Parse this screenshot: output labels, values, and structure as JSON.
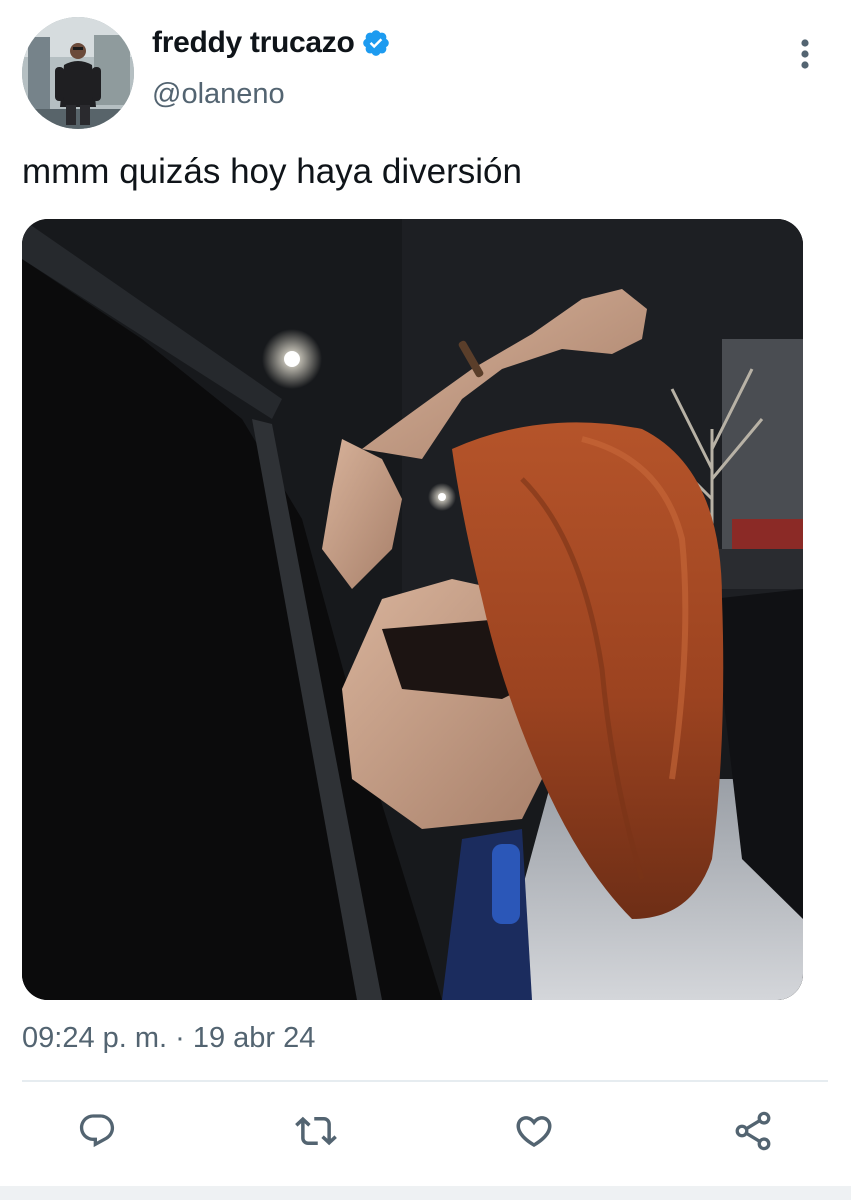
{
  "user": {
    "display_name": "freddy trucazo",
    "handle": "@olaneno",
    "verified": true
  },
  "tweet": {
    "text": "mmm quizás hoy haya diversión",
    "timestamp": "09:24 p. m. · 19 abr 24",
    "media": {
      "type": "photo"
    }
  },
  "actions": [
    {
      "icon": "reply-icon"
    },
    {
      "icon": "retweet-icon"
    },
    {
      "icon": "like-icon"
    },
    {
      "icon": "share-icon"
    }
  ],
  "colors": {
    "text_primary": "#0f1419",
    "text_secondary": "#536471",
    "verified_blue": "#1d9bf0",
    "divider": "#e6ecf0"
  }
}
